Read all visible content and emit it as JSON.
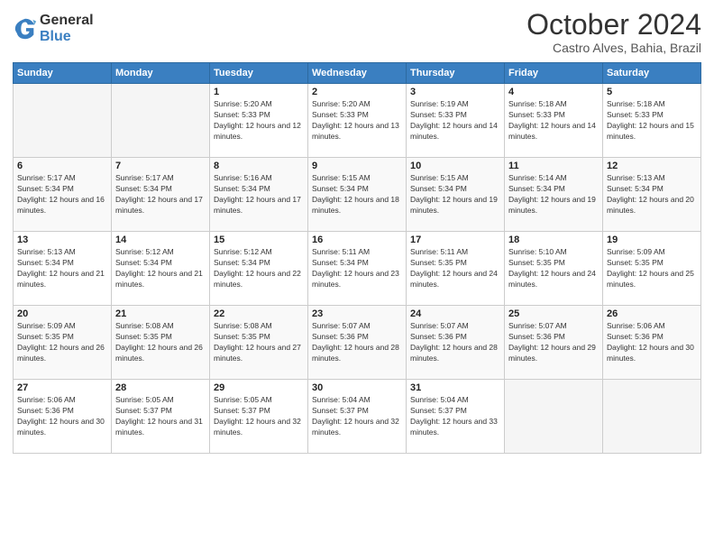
{
  "logo": {
    "general": "General",
    "blue": "Blue"
  },
  "title": "October 2024",
  "location": "Castro Alves, Bahia, Brazil",
  "days_of_week": [
    "Sunday",
    "Monday",
    "Tuesday",
    "Wednesday",
    "Thursday",
    "Friday",
    "Saturday"
  ],
  "weeks": [
    [
      {
        "day": "",
        "info": ""
      },
      {
        "day": "",
        "info": ""
      },
      {
        "day": "1",
        "info": "Sunrise: 5:20 AM\nSunset: 5:33 PM\nDaylight: 12 hours and 12 minutes."
      },
      {
        "day": "2",
        "info": "Sunrise: 5:20 AM\nSunset: 5:33 PM\nDaylight: 12 hours and 13 minutes."
      },
      {
        "day": "3",
        "info": "Sunrise: 5:19 AM\nSunset: 5:33 PM\nDaylight: 12 hours and 14 minutes."
      },
      {
        "day": "4",
        "info": "Sunrise: 5:18 AM\nSunset: 5:33 PM\nDaylight: 12 hours and 14 minutes."
      },
      {
        "day": "5",
        "info": "Sunrise: 5:18 AM\nSunset: 5:33 PM\nDaylight: 12 hours and 15 minutes."
      }
    ],
    [
      {
        "day": "6",
        "info": "Sunrise: 5:17 AM\nSunset: 5:34 PM\nDaylight: 12 hours and 16 minutes."
      },
      {
        "day": "7",
        "info": "Sunrise: 5:17 AM\nSunset: 5:34 PM\nDaylight: 12 hours and 17 minutes."
      },
      {
        "day": "8",
        "info": "Sunrise: 5:16 AM\nSunset: 5:34 PM\nDaylight: 12 hours and 17 minutes."
      },
      {
        "day": "9",
        "info": "Sunrise: 5:15 AM\nSunset: 5:34 PM\nDaylight: 12 hours and 18 minutes."
      },
      {
        "day": "10",
        "info": "Sunrise: 5:15 AM\nSunset: 5:34 PM\nDaylight: 12 hours and 19 minutes."
      },
      {
        "day": "11",
        "info": "Sunrise: 5:14 AM\nSunset: 5:34 PM\nDaylight: 12 hours and 19 minutes."
      },
      {
        "day": "12",
        "info": "Sunrise: 5:13 AM\nSunset: 5:34 PM\nDaylight: 12 hours and 20 minutes."
      }
    ],
    [
      {
        "day": "13",
        "info": "Sunrise: 5:13 AM\nSunset: 5:34 PM\nDaylight: 12 hours and 21 minutes."
      },
      {
        "day": "14",
        "info": "Sunrise: 5:12 AM\nSunset: 5:34 PM\nDaylight: 12 hours and 21 minutes."
      },
      {
        "day": "15",
        "info": "Sunrise: 5:12 AM\nSunset: 5:34 PM\nDaylight: 12 hours and 22 minutes."
      },
      {
        "day": "16",
        "info": "Sunrise: 5:11 AM\nSunset: 5:34 PM\nDaylight: 12 hours and 23 minutes."
      },
      {
        "day": "17",
        "info": "Sunrise: 5:11 AM\nSunset: 5:35 PM\nDaylight: 12 hours and 24 minutes."
      },
      {
        "day": "18",
        "info": "Sunrise: 5:10 AM\nSunset: 5:35 PM\nDaylight: 12 hours and 24 minutes."
      },
      {
        "day": "19",
        "info": "Sunrise: 5:09 AM\nSunset: 5:35 PM\nDaylight: 12 hours and 25 minutes."
      }
    ],
    [
      {
        "day": "20",
        "info": "Sunrise: 5:09 AM\nSunset: 5:35 PM\nDaylight: 12 hours and 26 minutes."
      },
      {
        "day": "21",
        "info": "Sunrise: 5:08 AM\nSunset: 5:35 PM\nDaylight: 12 hours and 26 minutes."
      },
      {
        "day": "22",
        "info": "Sunrise: 5:08 AM\nSunset: 5:35 PM\nDaylight: 12 hours and 27 minutes."
      },
      {
        "day": "23",
        "info": "Sunrise: 5:07 AM\nSunset: 5:36 PM\nDaylight: 12 hours and 28 minutes."
      },
      {
        "day": "24",
        "info": "Sunrise: 5:07 AM\nSunset: 5:36 PM\nDaylight: 12 hours and 28 minutes."
      },
      {
        "day": "25",
        "info": "Sunrise: 5:07 AM\nSunset: 5:36 PM\nDaylight: 12 hours and 29 minutes."
      },
      {
        "day": "26",
        "info": "Sunrise: 5:06 AM\nSunset: 5:36 PM\nDaylight: 12 hours and 30 minutes."
      }
    ],
    [
      {
        "day": "27",
        "info": "Sunrise: 5:06 AM\nSunset: 5:36 PM\nDaylight: 12 hours and 30 minutes."
      },
      {
        "day": "28",
        "info": "Sunrise: 5:05 AM\nSunset: 5:37 PM\nDaylight: 12 hours and 31 minutes."
      },
      {
        "day": "29",
        "info": "Sunrise: 5:05 AM\nSunset: 5:37 PM\nDaylight: 12 hours and 32 minutes."
      },
      {
        "day": "30",
        "info": "Sunrise: 5:04 AM\nSunset: 5:37 PM\nDaylight: 12 hours and 32 minutes."
      },
      {
        "day": "31",
        "info": "Sunrise: 5:04 AM\nSunset: 5:37 PM\nDaylight: 12 hours and 33 minutes."
      },
      {
        "day": "",
        "info": ""
      },
      {
        "day": "",
        "info": ""
      }
    ]
  ]
}
